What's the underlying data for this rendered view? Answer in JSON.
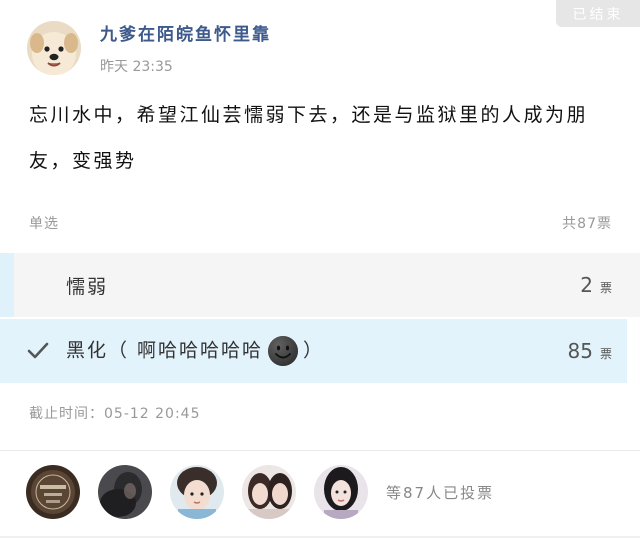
{
  "status": {
    "label": "已结束"
  },
  "author": {
    "name": "九爹在陌皖鱼怀里靠",
    "time": "昨天 23:35"
  },
  "post": {
    "content": "忘川水中，希望江仙芸懦弱下去，还是与监狱里的人成为朋友，变强势"
  },
  "vote": {
    "type": "单选",
    "total": "共87票",
    "options": [
      {
        "label": "懦弱",
        "count": "2",
        "unit": "票",
        "selected": false
      },
      {
        "label_before": "黑化（ 啊哈哈哈哈哈",
        "label_after": "）",
        "emoji": "smiling-dark-face-icon",
        "count": "85",
        "unit": "票",
        "selected": true
      }
    ],
    "deadline": "截止时间：05-12 20:45"
  },
  "voters": {
    "summary": "等87人已投票"
  },
  "colors": {
    "name": "#3e5a8c",
    "selected_bg": "#e3f3fc",
    "unselected_bg": "#f5f5f5"
  }
}
